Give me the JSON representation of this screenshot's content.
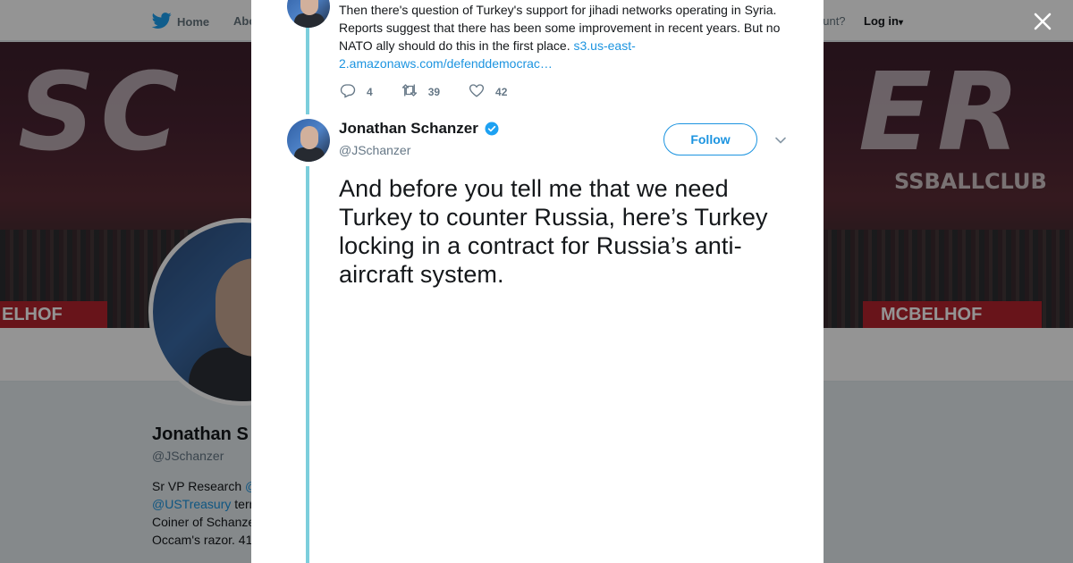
{
  "nav": {
    "home_label": "Home",
    "about_label": "Abo",
    "have_account_text": "ccount?",
    "login_label": "Log in",
    "login_caret": "▾"
  },
  "banner": {
    "big_left": "SC",
    "big_right": "ER",
    "sub_right": "SSBALLCLUB",
    "strip_left": "ELHOF",
    "strip_right": "MCBELHOF"
  },
  "profile": {
    "name": "Jonathan S",
    "handle": "@JSchanzer",
    "bio_line1_text": "Sr VP Research ",
    "bio_line1_link": "@",
    "bio_line2_link": "@USTreasury",
    "bio_line2_text": " terr",
    "bio_line3": "Coiner of Schanze",
    "bio_line4": "Occam's razor. 41"
  },
  "previous_tweet": {
    "text": "Then there's question of Turkey's support for jihadi networks operating in Syria. Reports suggest that there has been some improvement in recent years. But no NATO ally should do this in the first place. ",
    "link": "s3.us-east-2.amazonaws.com/defenddemocrac…",
    "replies": "4",
    "retweets": "39",
    "likes": "42"
  },
  "tweet": {
    "author_name": "Jonathan Schanzer",
    "author_handle": "@JSchanzer",
    "follow_label": "Follow",
    "text": "And before you tell me that we need Turkey to counter Russia, here’s Turkey locking in a contract for Russia’s anti-aircraft system."
  },
  "icons": {
    "twitter": "twitter-bird-icon",
    "close": "close-icon",
    "reply": "reply-icon",
    "retweet": "retweet-icon",
    "like": "heart-icon",
    "verified": "verified-badge-icon",
    "caret": "chevron-down-icon"
  },
  "colors": {
    "accent": "#1c94e0",
    "thread_line": "#7ccedc",
    "verified": "#1da1f2",
    "overlay": "rgba(0,0,0,0.42)"
  }
}
